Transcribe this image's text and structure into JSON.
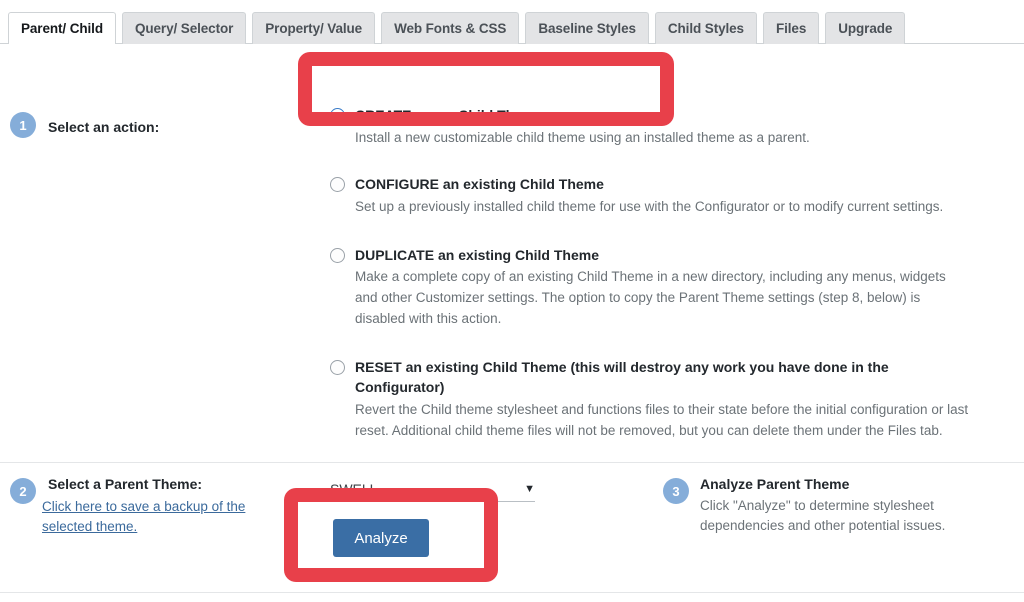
{
  "tabs": [
    {
      "label": "Parent/ Child",
      "active": true
    },
    {
      "label": "Query/ Selector",
      "active": false
    },
    {
      "label": "Property/ Value",
      "active": false
    },
    {
      "label": "Web Fonts & CSS",
      "active": false
    },
    {
      "label": "Baseline Styles",
      "active": false
    },
    {
      "label": "Child Styles",
      "active": false
    },
    {
      "label": "Files",
      "active": false
    },
    {
      "label": "Upgrade",
      "active": false
    }
  ],
  "step1": {
    "number": "1",
    "label": "Select an action:",
    "options": [
      {
        "title": "CREATE a new Child Theme",
        "description": "Install a new customizable child theme using an installed theme as a parent.",
        "selected": true
      },
      {
        "title": "CONFIGURE an existing Child Theme",
        "description": "Set up a previously installed child theme for use with the Configurator or to modify current settings.",
        "selected": false
      },
      {
        "title": "DUPLICATE an existing Child Theme",
        "description": "Make a complete copy of an existing Child Theme in a new directory, including any menus, widgets and other Customizer settings. The option to copy the Parent Theme settings (step 8, below) is disabled with this action.",
        "selected": false
      },
      {
        "title": "RESET an existing Child Theme (this will destroy any work you have done in the Configurator)",
        "description": "Revert the Child theme stylesheet and functions files to their state before the initial configuration or last reset. Additional child theme files will not be removed, but you can delete them under the Files tab.",
        "selected": false
      }
    ]
  },
  "step2": {
    "number": "2",
    "label": "Select a Parent Theme:",
    "backup_link": "Click here to save a backup of the selected theme.",
    "parent_theme_value": "SWELL",
    "caret_icon": "chevron-down-icon",
    "analyze_button": "Analyze"
  },
  "step3": {
    "number": "3",
    "label": "Analyze Parent Theme",
    "description": "Click \"Analyze\" to determine stylesheet dependencies and other potential issues."
  },
  "annotations": {
    "highlight_color": "#e8404a",
    "boxes": [
      {
        "name": "create-option-highlight"
      },
      {
        "name": "analyze-button-highlight"
      }
    ]
  },
  "colors": {
    "accent_blue": "#3a6ea5",
    "badge_blue": "#85add9",
    "radio_blue": "#2b6cb8",
    "link_blue": "#3b6a9c",
    "highlight_red": "#e8404a"
  }
}
